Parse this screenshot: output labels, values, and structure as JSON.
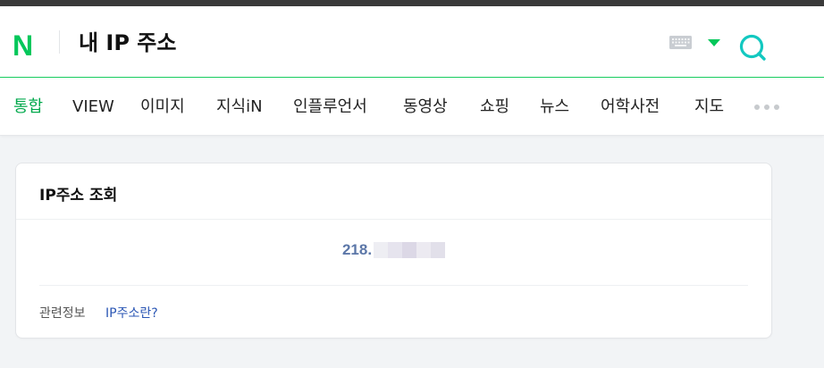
{
  "header": {
    "logo": "N",
    "query": "내 IP 주소",
    "keyboard_icon": "keyboard-icon",
    "dropdown_icon": "caret-down-icon",
    "search_icon": "search-icon",
    "accent": "#03c75a"
  },
  "tabs": [
    {
      "label": "통합",
      "active": true
    },
    {
      "label": "VIEW",
      "active": false
    },
    {
      "label": "이미지",
      "active": false
    },
    {
      "label": "지식iN",
      "active": false
    },
    {
      "label": "인플루언서",
      "active": false
    },
    {
      "label": "동영상",
      "active": false
    },
    {
      "label": "쇼핑",
      "active": false
    },
    {
      "label": "뉴스",
      "active": false
    },
    {
      "label": "어학사전",
      "active": false
    },
    {
      "label": "지도",
      "active": false
    }
  ],
  "more_icon": "more-dots-icon",
  "card": {
    "title": "IP주소 조회",
    "ip_visible": "218.",
    "ip_masked": true,
    "related_label": "관련정보",
    "related_link": "IP주소란?"
  }
}
